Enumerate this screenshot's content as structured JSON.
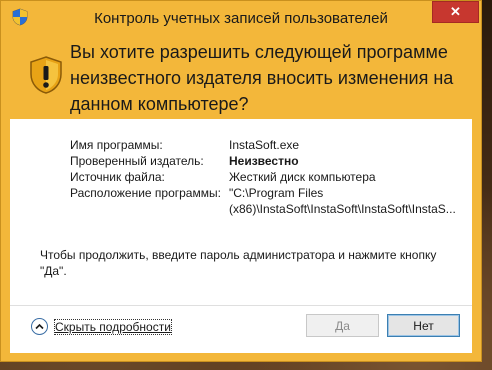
{
  "window": {
    "title": "Контроль учетных записей пользователей",
    "close_label": "✕"
  },
  "header": {
    "question": "Вы хотите разрешить следующей программе неизвестного издателя вносить изменения на данном компьютере?"
  },
  "details": [
    {
      "label": "Имя программы:",
      "value": "InstaSoft.exe",
      "bold": false
    },
    {
      "label": "Проверенный издатель:",
      "value": "Неизвестно",
      "bold": true
    },
    {
      "label": "Источник файла:",
      "value": "Жесткий диск компьютера",
      "bold": false
    },
    {
      "label": "Расположение программы:",
      "value": "\"C:\\Program Files",
      "bold": false
    },
    {
      "label": "",
      "value": "(x86)\\InstaSoft\\InstaSoft\\InstaSoft\\InstaS...",
      "bold": false
    }
  ],
  "prompt": "Чтобы продолжить, введите пароль администратора и нажмите кнопку \"Да\".",
  "footer": {
    "details_link": "Скрыть подробности",
    "yes_label": "Да",
    "no_label": "Нет"
  },
  "colors": {
    "accent": "#f3b73a",
    "close": "#c7372f",
    "button_focus": "#3c7fb1"
  },
  "icons": {
    "title_icon": "uac-shield-icon",
    "warning_icon": "warning-shield-icon",
    "toggle_icon": "chevron-up-icon"
  }
}
